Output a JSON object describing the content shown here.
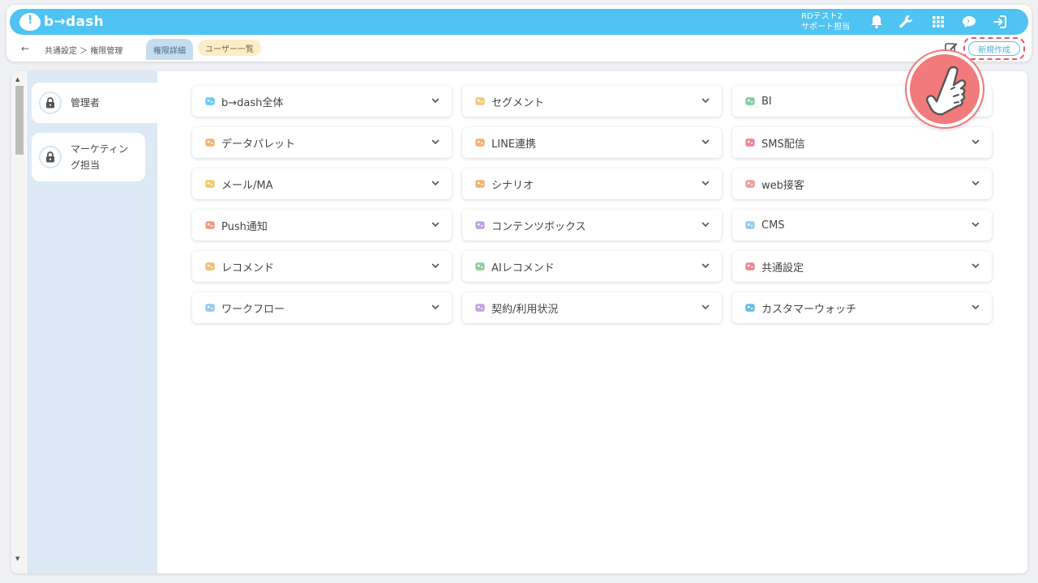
{
  "app": {
    "logo_text": "b→dash"
  },
  "user": {
    "line1": "RDテスト2",
    "line2": "サポート担当"
  },
  "topbar_icons": [
    "bell-icon",
    "wrench-icon",
    "grid-icon",
    "help-chat-icon",
    "logout-icon"
  ],
  "breadcrumb": "共通設定 ＞ 権限管理",
  "tabs": {
    "detail": "権限詳細",
    "users": "ユーザー一覧"
  },
  "new_button": "新規作成",
  "roles": [
    {
      "label": "管理者",
      "active": true
    },
    {
      "label": "マーケティング担当",
      "line1": "マーケティン",
      "line2": "グ担当",
      "active": false
    }
  ],
  "features": [
    {
      "label": "b→dash全体",
      "icon": "cloud-icon",
      "color": "#4fc3f2"
    },
    {
      "label": "セグメント",
      "icon": "segment-icon",
      "color": "#f0c06a"
    },
    {
      "label": "BI",
      "icon": "chart-icon",
      "color": "#6cc58f"
    },
    {
      "label": "データパレット",
      "icon": "palette-icon",
      "color": "#f0a45a"
    },
    {
      "label": "LINE連携",
      "icon": "line-icon",
      "color": "#f4a25c"
    },
    {
      "label": "SMS配信",
      "icon": "sms-icon",
      "color": "#ec6f7f"
    },
    {
      "label": "メール/MA",
      "icon": "mail-icon",
      "color": "#f2c24e"
    },
    {
      "label": "シナリオ",
      "icon": "scenario-icon",
      "color": "#f0a45a"
    },
    {
      "label": "web接客",
      "icon": "web-icon",
      "color": "#ec8c8c"
    },
    {
      "label": "Push通知",
      "icon": "push-icon",
      "color": "#f08a6a"
    },
    {
      "label": "コンテンツボックス",
      "icon": "content-box-icon",
      "color": "#b393d6"
    },
    {
      "label": "CMS",
      "icon": "cms-icon",
      "color": "#7fc4e6"
    },
    {
      "label": "レコメンド",
      "icon": "recommend-icon",
      "color": "#f0b25a"
    },
    {
      "label": "AIレコメンド",
      "icon": "ai-recommend-icon",
      "color": "#7cc48a"
    },
    {
      "label": "共通設定",
      "icon": "settings-icon",
      "color": "#ec6f7f"
    },
    {
      "label": "ワークフロー",
      "icon": "workflow-icon",
      "color": "#7fc4e6"
    },
    {
      "label": "契約/利用状況",
      "icon": "contract-icon",
      "color": "#b393d6"
    },
    {
      "label": "カスタマーウォッチ",
      "icon": "customer-watch-icon",
      "color": "#4fb0df"
    }
  ]
}
